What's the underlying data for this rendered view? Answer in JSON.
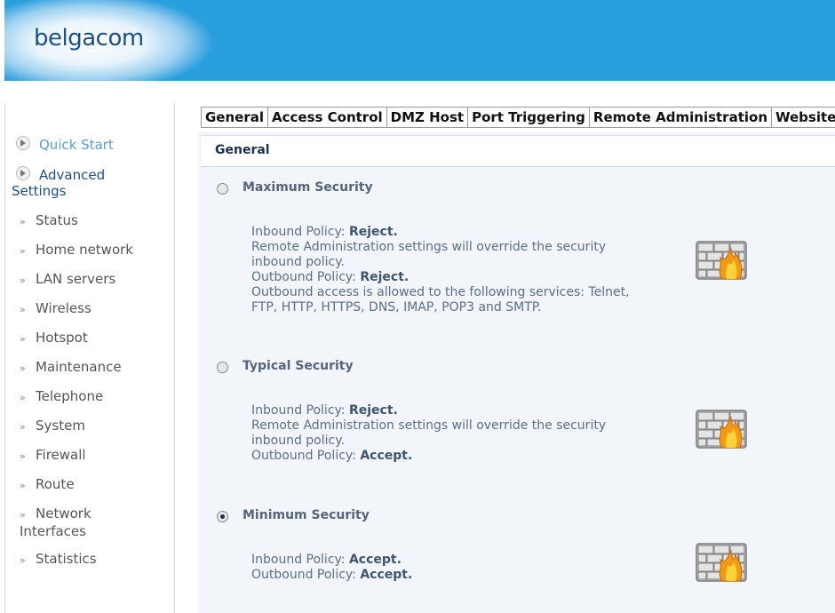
{
  "header": {
    "logo": "belgacom"
  },
  "sidebar": {
    "quick_start": "Quick Start",
    "advanced_settings": "Advanced Settings",
    "items": [
      "Status",
      "Home network",
      "LAN servers",
      "Wireless",
      "Hotspot",
      "Maintenance",
      "Telephone",
      "System",
      "Firewall",
      "Route",
      "Network Interfaces",
      "Statistics"
    ]
  },
  "tabs": [
    "General",
    "Access Control",
    "DMZ Host",
    "Port Triggering",
    "Remote Administration",
    "Website"
  ],
  "section_title": "General",
  "options": [
    {
      "title": "Maximum Security",
      "selected": false,
      "lines": [
        {
          "text": "Inbound Policy: ",
          "bold": "Reject."
        },
        {
          "text": "Remote Administration settings will override the security inbound policy."
        },
        {
          "text": "Outbound Policy: ",
          "bold": "Reject."
        },
        {
          "text": "Outbound access is allowed to the following services: Telnet, FTP, HTTP, HTTPS, DNS, IMAP, POP3 and SMTP."
        }
      ]
    },
    {
      "title": "Typical Security",
      "selected": false,
      "lines": [
        {
          "text": "Inbound Policy: ",
          "bold": "Reject."
        },
        {
          "text": "Remote Administration settings will override the security inbound policy."
        },
        {
          "text": "Outbound Policy: ",
          "bold": "Accept."
        }
      ]
    },
    {
      "title": "Minimum Security",
      "selected": true,
      "lines": [
        {
          "text": "Inbound Policy: ",
          "bold": "Accept."
        },
        {
          "text": "Outbound Policy: ",
          "bold": "Accept."
        }
      ]
    }
  ],
  "colors": {
    "header_bg": "#2a9fde",
    "logo": "#1b4f8a",
    "content_bg": "#f2f5f9"
  }
}
